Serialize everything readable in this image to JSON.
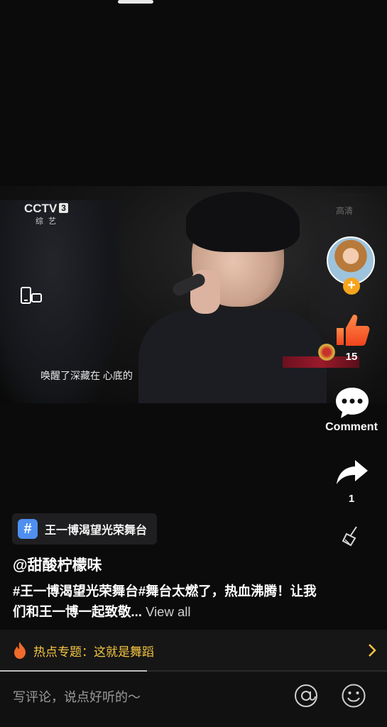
{
  "video": {
    "channel_logo": "CCTV",
    "channel_number": "3",
    "channel_sub": "综 艺",
    "hd_mark": "高清",
    "subtitle": "唤醒了深藏在  心底的"
  },
  "rail": {
    "like_count": "15",
    "comment_label": "Comment",
    "share_count": "1",
    "icons": [
      "avatar",
      "follow-plus-icon",
      "thumbs-up-icon",
      "comment-bubble-icon",
      "share-arrow-icon",
      "broom-icon"
    ]
  },
  "topic": {
    "hash": "#",
    "label": "王一博渴望光荣舞台"
  },
  "author": "@甜酸柠檬味",
  "caption": {
    "text": "#王一博渴望光荣舞台#舞台太燃了，热血沸腾！让我们和王一博一起致敬...",
    "view_all": "View all"
  },
  "hot_topic": {
    "text": "热点专题：这就是舞蹈"
  },
  "playback_progress_percent": 38,
  "comment_bar": {
    "placeholder": "写评论，说点好听的～"
  },
  "colors": {
    "accent_orange": "#f7a41d",
    "hot_text": "#f5c542",
    "hash_blue": "#4f8ff0"
  }
}
